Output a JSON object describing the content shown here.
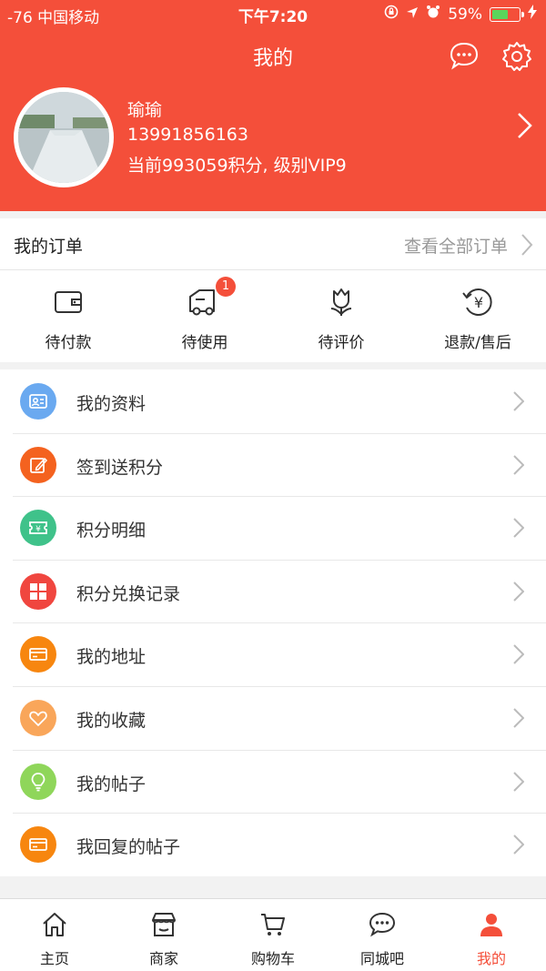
{
  "status_bar": {
    "signal": "-76 中国移动",
    "time": "下午7:20",
    "battery": "59%",
    "battery_level": 0.59
  },
  "header": {
    "title": "我的",
    "chat_icon": "chat-bubble-icon",
    "settings_icon": "gear-icon",
    "accent_color": "#f44f3a"
  },
  "profile": {
    "name": "瑜瑜",
    "phone": "13991856163",
    "points_text": "当前993059积分, 级别VIP9"
  },
  "orders": {
    "title": "我的订单",
    "view_all": "查看全部订单",
    "tabs": [
      {
        "label": "待付款",
        "icon": "wallet-icon"
      },
      {
        "label": "待使用",
        "icon": "truck-icon",
        "badge": "1"
      },
      {
        "label": "待评价",
        "icon": "flower-icon"
      },
      {
        "label": "退款/售后",
        "icon": "refund-icon"
      }
    ]
  },
  "menu": [
    {
      "label": "我的资料",
      "icon": "profile-card-icon",
      "color": "#6aa9f0"
    },
    {
      "label": "签到送积分",
      "icon": "edit-icon",
      "color": "#f4621f"
    },
    {
      "label": "积分明细",
      "icon": "ticket-icon",
      "color": "#3fc28a"
    },
    {
      "label": "积分兑换记录",
      "icon": "grid-icon",
      "color": "#f0463f"
    },
    {
      "label": "我的地址",
      "icon": "card-icon",
      "color": "#f7860f"
    },
    {
      "label": "我的收藏",
      "icon": "heart-icon",
      "color": "#f9a65a"
    },
    {
      "label": "我的帖子",
      "icon": "bulb-icon",
      "color": "#8fd65a"
    },
    {
      "label": "我回复的帖子",
      "icon": "card-icon",
      "color": "#f7860f"
    }
  ],
  "tabbar": [
    {
      "label": "主页",
      "icon": "home-icon"
    },
    {
      "label": "商家",
      "icon": "store-icon"
    },
    {
      "label": "购物车",
      "icon": "cart-icon"
    },
    {
      "label": "同城吧",
      "icon": "chat-bubble-icon"
    },
    {
      "label": "我的",
      "icon": "person-icon",
      "active": true
    }
  ]
}
